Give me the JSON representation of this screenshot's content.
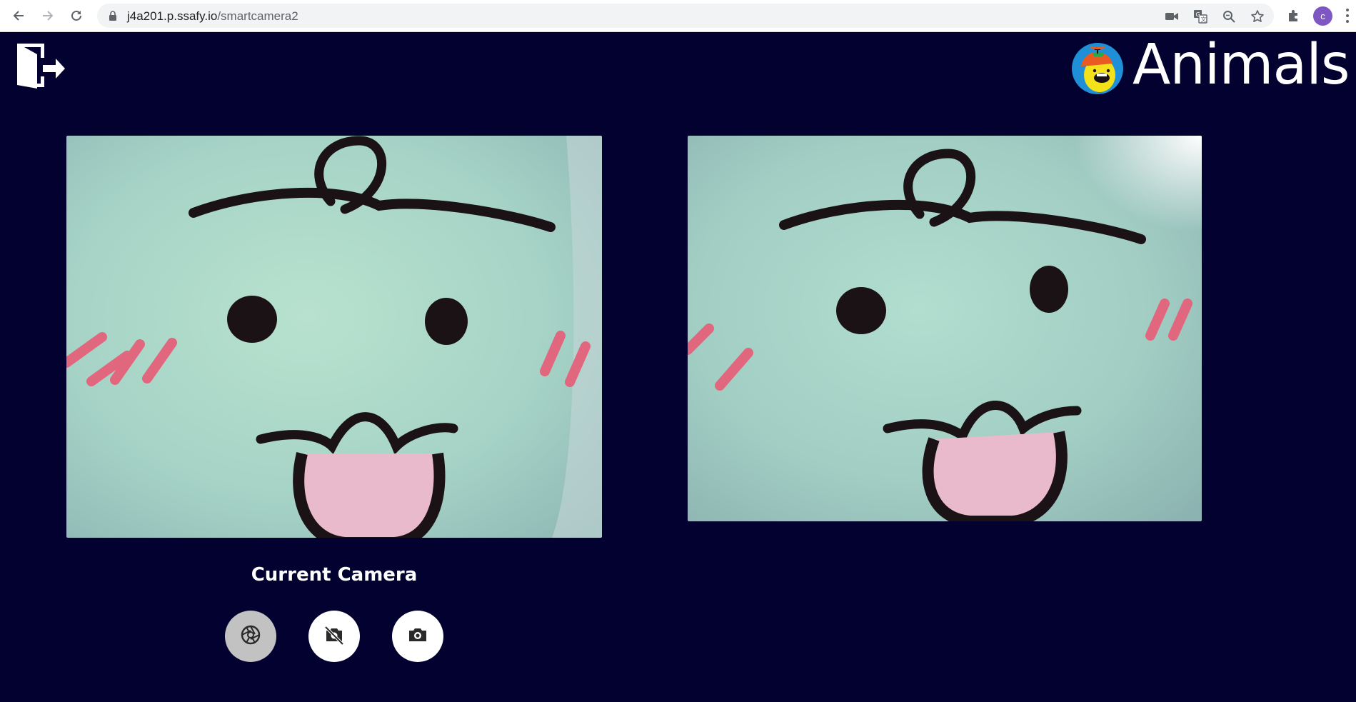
{
  "browser": {
    "url_host": "j4a201.p.ssafy.io",
    "url_path": "/smartcamera2",
    "profile_initial": "c",
    "icons": [
      "back-arrow-icon",
      "forward-arrow-icon",
      "reload-icon",
      "lock-icon",
      "camera-in-use-icon",
      "translate-icon",
      "zoom-icon",
      "bookmark-star-icon",
      "extensions-puzzle-icon",
      "menu-kebab-icon"
    ]
  },
  "app": {
    "brand_title": "Animals",
    "logout_icon": "logout-door-icon",
    "mascot_icon": "mascot-logo-icon",
    "current_camera_label": "Current Camera",
    "controls": [
      {
        "name": "shutter",
        "icon": "aperture-icon"
      },
      {
        "name": "camera-off",
        "icon": "camera-off-icon"
      },
      {
        "name": "capture",
        "icon": "camera-icon"
      }
    ]
  },
  "colors": {
    "background": "#020130",
    "plush": "#a9d8c6",
    "blush": "#e0677e",
    "ink": "#1a1214",
    "tongue": "#e9b9cc"
  }
}
